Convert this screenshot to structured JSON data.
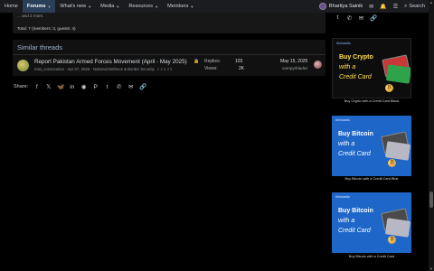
{
  "nav": {
    "items": [
      {
        "label": "Home",
        "active": false
      },
      {
        "label": "Forums",
        "active": true
      },
      {
        "label": "What's new",
        "active": false
      },
      {
        "label": "Media",
        "active": false
      },
      {
        "label": "Resources",
        "active": false
      },
      {
        "label": "Members",
        "active": false
      }
    ],
    "user_name": "Bhartiya Sainik",
    "search_label": "Search"
  },
  "online": {
    "names_line": "... and 2 more.",
    "total": "Total: 7 (members: 3, guests: 4)"
  },
  "similar": {
    "title": "Similar threads",
    "thread": {
      "title": "Report Pakistan Armed Forces Movement (April - May 2025)",
      "meta": "mist_consecutive · Apr 27, 2025 · National Defence & Border Security",
      "pages": "1  2  3  4  5",
      "replies_label": "Replies:",
      "replies_value": "103",
      "views_label": "Views:",
      "views_value": "2K",
      "last_date": "May 15, 2025",
      "last_user": "vampyrbladez"
    }
  },
  "share": {
    "label": "Share:",
    "icons": [
      "facebook-icon",
      "x-icon",
      "bluesky-icon",
      "linkedin-icon",
      "reddit-icon",
      "pinterest-icon",
      "tumblr-icon",
      "whatsapp-icon",
      "email-icon",
      "link-icon"
    ]
  },
  "ads": [
    {
      "tag": "#Intaadla",
      "head": "Buy Crypto",
      "sub1": "with a",
      "sub2": "Credit Card",
      "caption": "Buy Crypto with a Credit Card Black",
      "style": "dark"
    },
    {
      "tag": "#Intaadla",
      "head": "Buy Bitcoin",
      "sub1": "with a",
      "sub2": "Credit Card",
      "caption": "Buy Bitcoin with a Credit Card Blue",
      "style": "blue"
    },
    {
      "tag": "#Intaadla",
      "head": "Buy Bitcoin",
      "sub1": "with a",
      "sub2": "Credit Card",
      "caption": "Buy Bitcoin with a Credit Card",
      "style": "blue"
    }
  ],
  "colors": {
    "nav_bg": "#1b1c1f",
    "nav_active": "#2a3f59",
    "ad_blue": "#1f66c9",
    "ad_yellow": "#ffe04d"
  }
}
